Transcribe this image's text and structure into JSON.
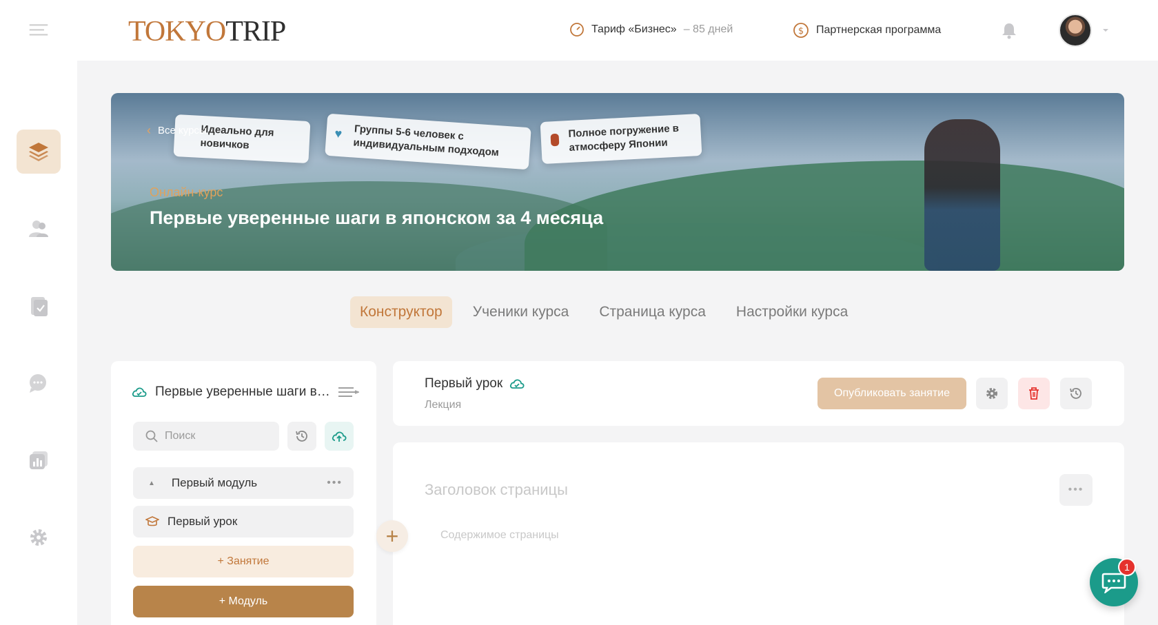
{
  "app": {
    "logo_part1": "TOKYO",
    "logo_part2": "TRIP"
  },
  "header": {
    "tariff_label": "Тариф «Бизнес»",
    "tariff_days": "– 85 дней",
    "partner_label": "Партнерская программа"
  },
  "sidebar": {
    "items": [
      {
        "icon": "courses-icon",
        "active": true
      },
      {
        "icon": "users-icon",
        "active": false
      },
      {
        "icon": "assignments-icon",
        "active": false
      },
      {
        "icon": "chat-icon",
        "active": false
      },
      {
        "icon": "analytics-icon",
        "active": false
      },
      {
        "icon": "settings-icon",
        "active": false
      }
    ]
  },
  "banner": {
    "back_link": "Все курсы",
    "badges": [
      "Идеально для новичков",
      "Группы 5-6 человек с индивидуальным подходом",
      "Полное погружение в атмосферу Японии"
    ],
    "subtitle": "Онлайн-курс",
    "title": "Первые уверенные шаги в японском за 4 месяца"
  },
  "tabs": [
    {
      "label": "Конструктор",
      "active": true
    },
    {
      "label": "Ученики курса",
      "active": false
    },
    {
      "label": "Страница курса",
      "active": false
    },
    {
      "label": "Настройки курса",
      "active": false
    }
  ],
  "structure": {
    "course_title": "Первые уверенные шаги в японском за 4 месяца",
    "search_placeholder": "Поиск",
    "module_label": "Первый модуль",
    "lesson_label": "Первый урок",
    "add_lesson_label": "+ Занятие",
    "add_module_label": "+ Модуль"
  },
  "lesson": {
    "title": "Первый урок",
    "type": "Лекция",
    "publish_label": "Опубликовать занятие"
  },
  "page_editor": {
    "title_placeholder": "Заголовок страницы",
    "content_placeholder": "Содержимое страницы"
  },
  "chat": {
    "unread_count": "1"
  },
  "colors": {
    "accent": "#c1773a",
    "accent_light": "#f3e4d2",
    "primary_button": "#b8844a",
    "sync_green": "#1b9b8a",
    "danger": "#e5322d"
  }
}
